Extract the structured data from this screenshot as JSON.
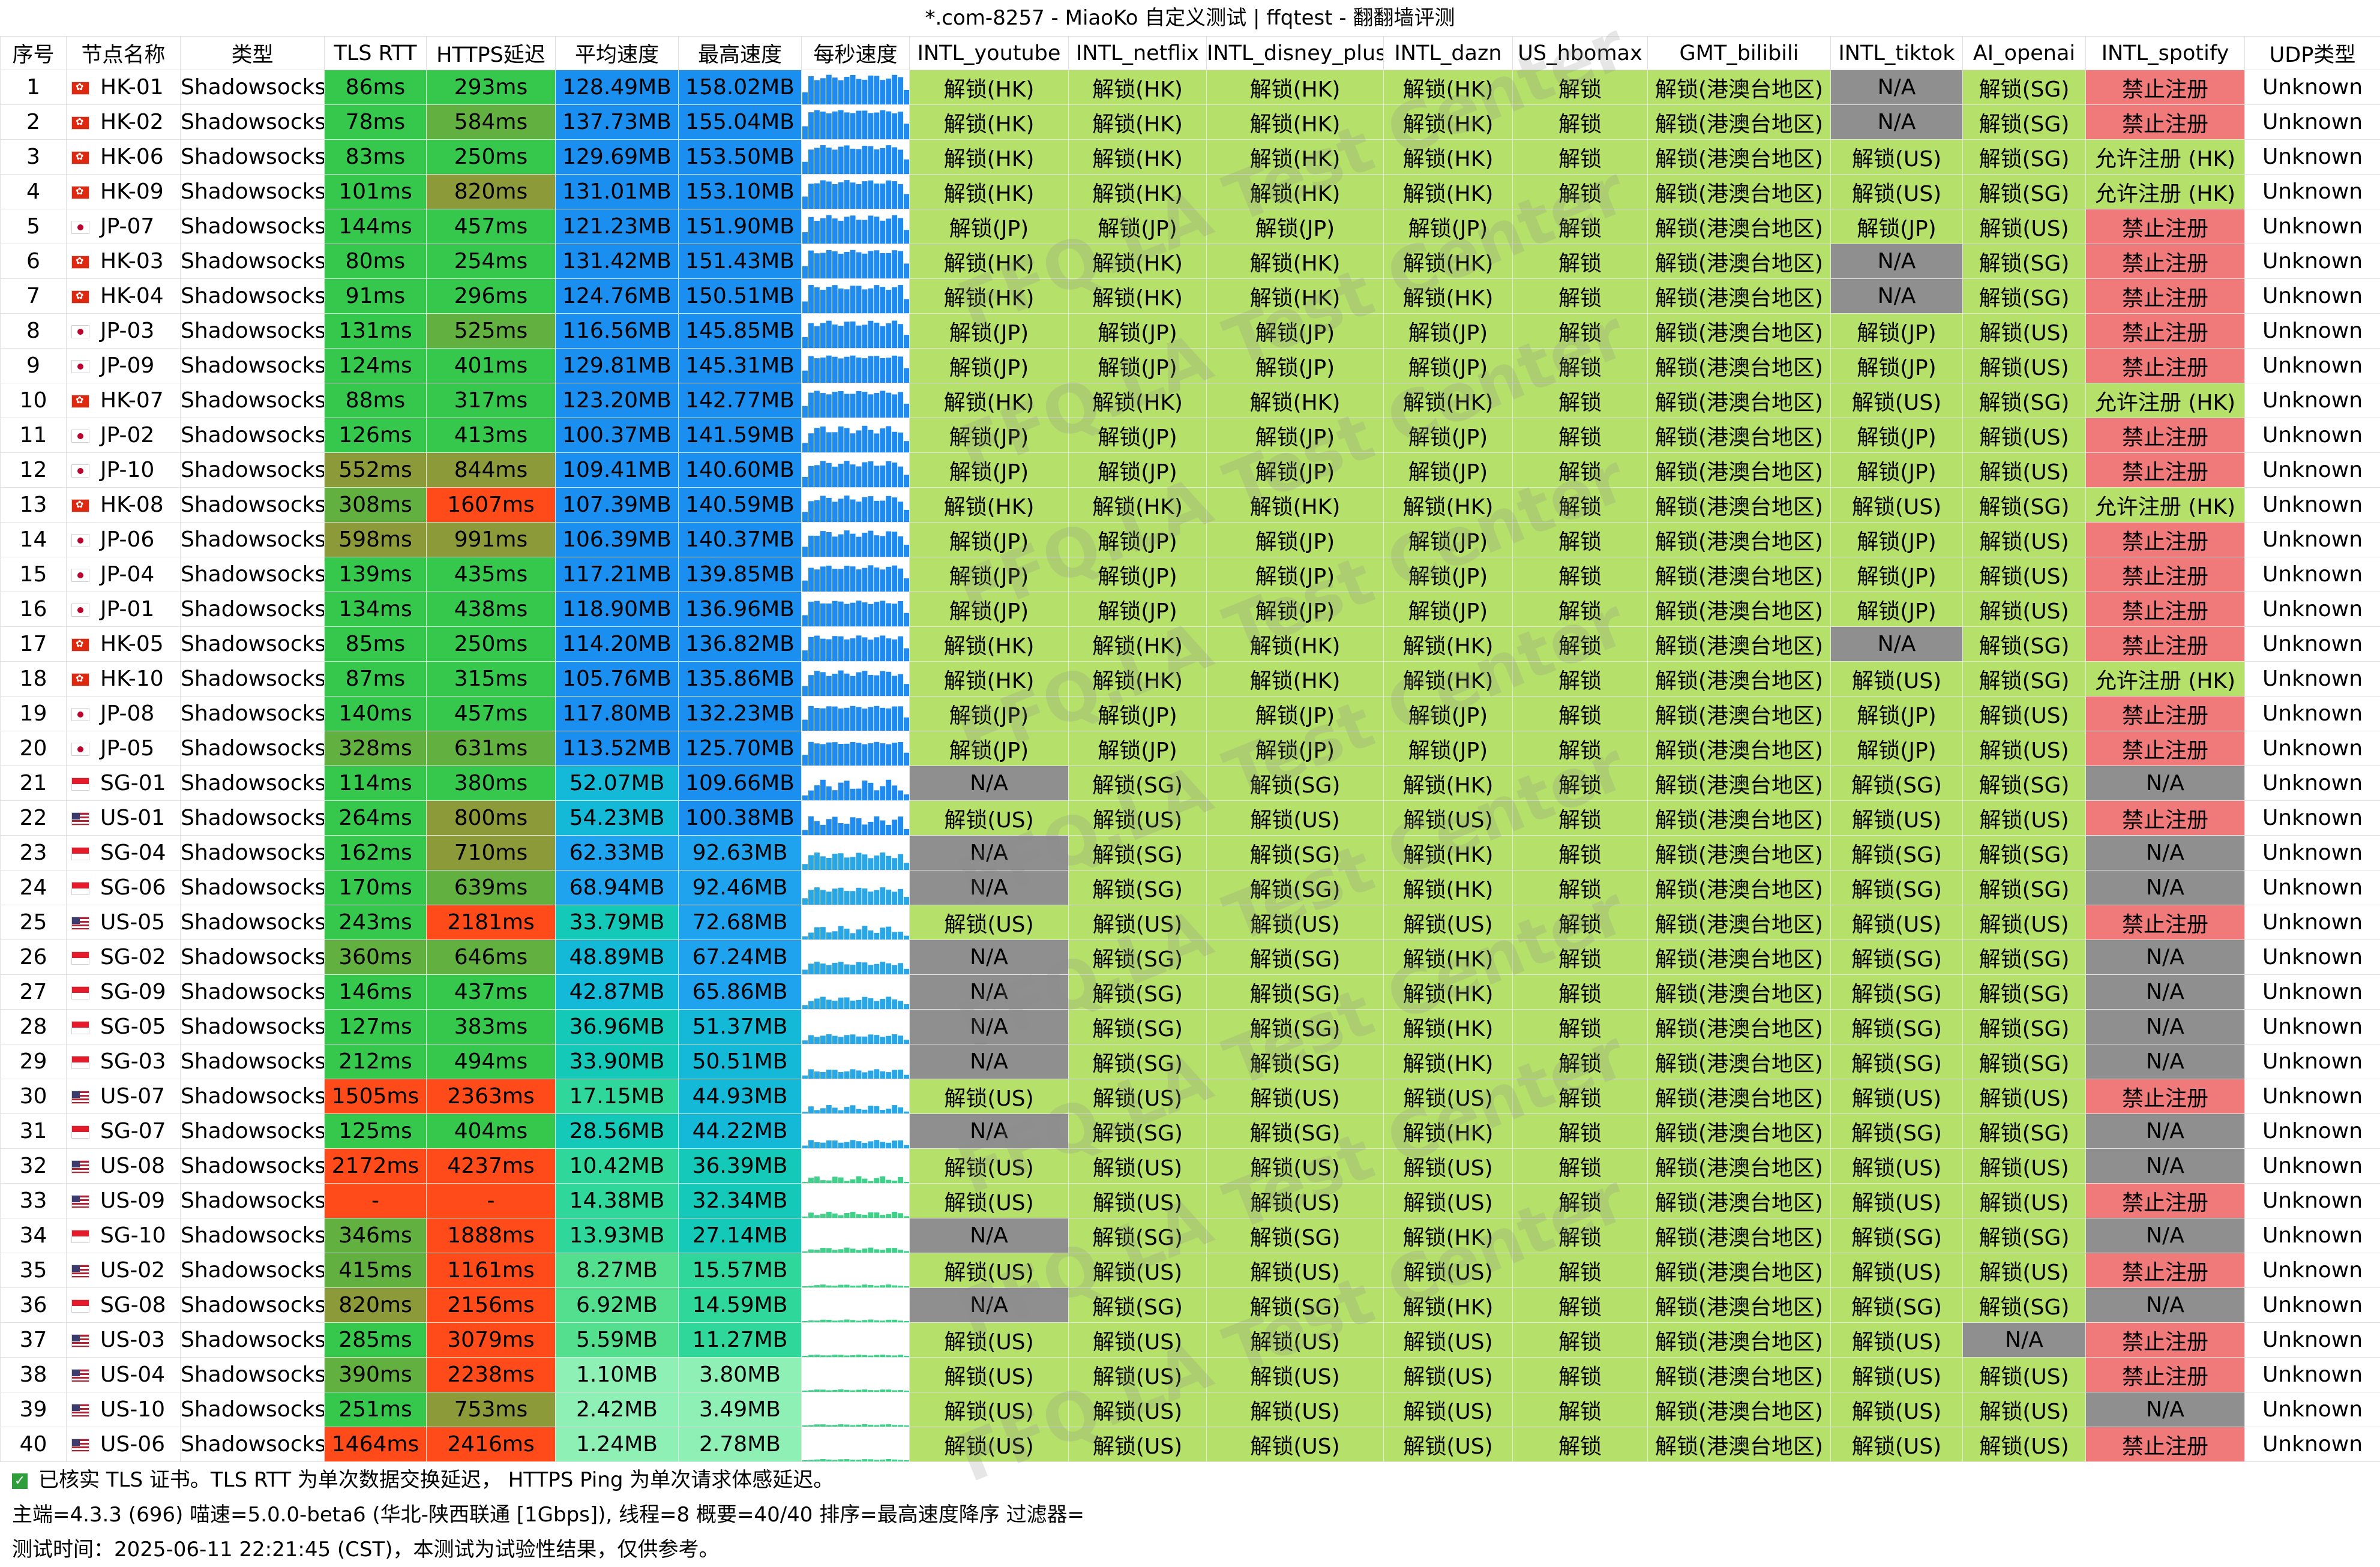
{
  "window_title": "*.com-8257 - MiaoKo 自定义测试 | ffqtest - 翻翻墙评测",
  "watermark": "FFQ.LA Test Center",
  "columns": [
    "序号",
    "节点名称",
    "类型",
    "TLS RTT",
    "HTTPS延迟",
    "平均速度",
    "最高速度",
    "每秒速度",
    "INTL_youtube",
    "INTL_netflix",
    "INTL_disney_plus",
    "INTL_dazn",
    "US_hbomax",
    "GMT_bilibili",
    "INTL_tiktok",
    "AI_openai",
    "INTL_spotify",
    "UDP类型"
  ],
  "rows": [
    {
      "idx": "1",
      "flag": "hk",
      "name": "HK-01",
      "type": "Shadowsocks",
      "tls": "86ms",
      "https": "293ms",
      "avg": "128.49MB",
      "max": "158.02MB",
      "yt": "解锁(HK)",
      "nf": "解锁(HK)",
      "dp": "解锁(HK)",
      "dazn": "解锁(HK)",
      "hbo": "解锁",
      "bili": "解锁(港澳台地区)",
      "tt": "N/A",
      "ai": "解锁(SG)",
      "sp": "禁止注册",
      "udp": "Unknown"
    },
    {
      "idx": "2",
      "flag": "hk",
      "name": "HK-02",
      "type": "Shadowsocks",
      "tls": "78ms",
      "https": "584ms",
      "avg": "137.73MB",
      "max": "155.04MB",
      "yt": "解锁(HK)",
      "nf": "解锁(HK)",
      "dp": "解锁(HK)",
      "dazn": "解锁(HK)",
      "hbo": "解锁",
      "bili": "解锁(港澳台地区)",
      "tt": "N/A",
      "ai": "解锁(SG)",
      "sp": "禁止注册",
      "udp": "Unknown"
    },
    {
      "idx": "3",
      "flag": "hk",
      "name": "HK-06",
      "type": "Shadowsocks",
      "tls": "83ms",
      "https": "250ms",
      "avg": "129.69MB",
      "max": "153.50MB",
      "yt": "解锁(HK)",
      "nf": "解锁(HK)",
      "dp": "解锁(HK)",
      "dazn": "解锁(HK)",
      "hbo": "解锁",
      "bili": "解锁(港澳台地区)",
      "tt": "解锁(US)",
      "ai": "解锁(SG)",
      "sp": "允许注册 (HK)",
      "udp": "Unknown"
    },
    {
      "idx": "4",
      "flag": "hk",
      "name": "HK-09",
      "type": "Shadowsocks",
      "tls": "101ms",
      "https": "820ms",
      "avg": "131.01MB",
      "max": "153.10MB",
      "yt": "解锁(HK)",
      "nf": "解锁(HK)",
      "dp": "解锁(HK)",
      "dazn": "解锁(HK)",
      "hbo": "解锁",
      "bili": "解锁(港澳台地区)",
      "tt": "解锁(US)",
      "ai": "解锁(SG)",
      "sp": "允许注册 (HK)",
      "udp": "Unknown"
    },
    {
      "idx": "5",
      "flag": "jp",
      "name": "JP-07",
      "type": "Shadowsocks",
      "tls": "144ms",
      "https": "457ms",
      "avg": "121.23MB",
      "max": "151.90MB",
      "yt": "解锁(JP)",
      "nf": "解锁(JP)",
      "dp": "解锁(JP)",
      "dazn": "解锁(JP)",
      "hbo": "解锁",
      "bili": "解锁(港澳台地区)",
      "tt": "解锁(JP)",
      "ai": "解锁(US)",
      "sp": "禁止注册",
      "udp": "Unknown"
    },
    {
      "idx": "6",
      "flag": "hk",
      "name": "HK-03",
      "type": "Shadowsocks",
      "tls": "80ms",
      "https": "254ms",
      "avg": "131.42MB",
      "max": "151.43MB",
      "yt": "解锁(HK)",
      "nf": "解锁(HK)",
      "dp": "解锁(HK)",
      "dazn": "解锁(HK)",
      "hbo": "解锁",
      "bili": "解锁(港澳台地区)",
      "tt": "N/A",
      "ai": "解锁(SG)",
      "sp": "禁止注册",
      "udp": "Unknown"
    },
    {
      "idx": "7",
      "flag": "hk",
      "name": "HK-04",
      "type": "Shadowsocks",
      "tls": "91ms",
      "https": "296ms",
      "avg": "124.76MB",
      "max": "150.51MB",
      "yt": "解锁(HK)",
      "nf": "解锁(HK)",
      "dp": "解锁(HK)",
      "dazn": "解锁(HK)",
      "hbo": "解锁",
      "bili": "解锁(港澳台地区)",
      "tt": "N/A",
      "ai": "解锁(SG)",
      "sp": "禁止注册",
      "udp": "Unknown"
    },
    {
      "idx": "8",
      "flag": "jp",
      "name": "JP-03",
      "type": "Shadowsocks",
      "tls": "131ms",
      "https": "525ms",
      "avg": "116.56MB",
      "max": "145.85MB",
      "yt": "解锁(JP)",
      "nf": "解锁(JP)",
      "dp": "解锁(JP)",
      "dazn": "解锁(JP)",
      "hbo": "解锁",
      "bili": "解锁(港澳台地区)",
      "tt": "解锁(JP)",
      "ai": "解锁(US)",
      "sp": "禁止注册",
      "udp": "Unknown"
    },
    {
      "idx": "9",
      "flag": "jp",
      "name": "JP-09",
      "type": "Shadowsocks",
      "tls": "124ms",
      "https": "401ms",
      "avg": "129.81MB",
      "max": "145.31MB",
      "yt": "解锁(JP)",
      "nf": "解锁(JP)",
      "dp": "解锁(JP)",
      "dazn": "解锁(JP)",
      "hbo": "解锁",
      "bili": "解锁(港澳台地区)",
      "tt": "解锁(JP)",
      "ai": "解锁(US)",
      "sp": "禁止注册",
      "udp": "Unknown"
    },
    {
      "idx": "10",
      "flag": "hk",
      "name": "HK-07",
      "type": "Shadowsocks",
      "tls": "88ms",
      "https": "317ms",
      "avg": "123.20MB",
      "max": "142.77MB",
      "yt": "解锁(HK)",
      "nf": "解锁(HK)",
      "dp": "解锁(HK)",
      "dazn": "解锁(HK)",
      "hbo": "解锁",
      "bili": "解锁(港澳台地区)",
      "tt": "解锁(US)",
      "ai": "解锁(SG)",
      "sp": "允许注册 (HK)",
      "udp": "Unknown"
    },
    {
      "idx": "11",
      "flag": "jp",
      "name": "JP-02",
      "type": "Shadowsocks",
      "tls": "126ms",
      "https": "413ms",
      "avg": "100.37MB",
      "max": "141.59MB",
      "yt": "解锁(JP)",
      "nf": "解锁(JP)",
      "dp": "解锁(JP)",
      "dazn": "解锁(JP)",
      "hbo": "解锁",
      "bili": "解锁(港澳台地区)",
      "tt": "解锁(JP)",
      "ai": "解锁(US)",
      "sp": "禁止注册",
      "udp": "Unknown"
    },
    {
      "idx": "12",
      "flag": "jp",
      "name": "JP-10",
      "type": "Shadowsocks",
      "tls": "552ms",
      "https": "844ms",
      "avg": "109.41MB",
      "max": "140.60MB",
      "yt": "解锁(JP)",
      "nf": "解锁(JP)",
      "dp": "解锁(JP)",
      "dazn": "解锁(JP)",
      "hbo": "解锁",
      "bili": "解锁(港澳台地区)",
      "tt": "解锁(JP)",
      "ai": "解锁(US)",
      "sp": "禁止注册",
      "udp": "Unknown"
    },
    {
      "idx": "13",
      "flag": "hk",
      "name": "HK-08",
      "type": "Shadowsocks",
      "tls": "308ms",
      "https": "1607ms",
      "avg": "107.39MB",
      "max": "140.59MB",
      "yt": "解锁(HK)",
      "nf": "解锁(HK)",
      "dp": "解锁(HK)",
      "dazn": "解锁(HK)",
      "hbo": "解锁",
      "bili": "解锁(港澳台地区)",
      "tt": "解锁(US)",
      "ai": "解锁(SG)",
      "sp": "允许注册 (HK)",
      "udp": "Unknown"
    },
    {
      "idx": "14",
      "flag": "jp",
      "name": "JP-06",
      "type": "Shadowsocks",
      "tls": "598ms",
      "https": "991ms",
      "avg": "106.39MB",
      "max": "140.37MB",
      "yt": "解锁(JP)",
      "nf": "解锁(JP)",
      "dp": "解锁(JP)",
      "dazn": "解锁(JP)",
      "hbo": "解锁",
      "bili": "解锁(港澳台地区)",
      "tt": "解锁(JP)",
      "ai": "解锁(US)",
      "sp": "禁止注册",
      "udp": "Unknown"
    },
    {
      "idx": "15",
      "flag": "jp",
      "name": "JP-04",
      "type": "Shadowsocks",
      "tls": "139ms",
      "https": "435ms",
      "avg": "117.21MB",
      "max": "139.85MB",
      "yt": "解锁(JP)",
      "nf": "解锁(JP)",
      "dp": "解锁(JP)",
      "dazn": "解锁(JP)",
      "hbo": "解锁",
      "bili": "解锁(港澳台地区)",
      "tt": "解锁(JP)",
      "ai": "解锁(US)",
      "sp": "禁止注册",
      "udp": "Unknown"
    },
    {
      "idx": "16",
      "flag": "jp",
      "name": "JP-01",
      "type": "Shadowsocks",
      "tls": "134ms",
      "https": "438ms",
      "avg": "118.90MB",
      "max": "136.96MB",
      "yt": "解锁(JP)",
      "nf": "解锁(JP)",
      "dp": "解锁(JP)",
      "dazn": "解锁(JP)",
      "hbo": "解锁",
      "bili": "解锁(港澳台地区)",
      "tt": "解锁(JP)",
      "ai": "解锁(US)",
      "sp": "禁止注册",
      "udp": "Unknown"
    },
    {
      "idx": "17",
      "flag": "hk",
      "name": "HK-05",
      "type": "Shadowsocks",
      "tls": "85ms",
      "https": "250ms",
      "avg": "114.20MB",
      "max": "136.82MB",
      "yt": "解锁(HK)",
      "nf": "解锁(HK)",
      "dp": "解锁(HK)",
      "dazn": "解锁(HK)",
      "hbo": "解锁",
      "bili": "解锁(港澳台地区)",
      "tt": "N/A",
      "ai": "解锁(SG)",
      "sp": "禁止注册",
      "udp": "Unknown"
    },
    {
      "idx": "18",
      "flag": "hk",
      "name": "HK-10",
      "type": "Shadowsocks",
      "tls": "87ms",
      "https": "315ms",
      "avg": "105.76MB",
      "max": "135.86MB",
      "yt": "解锁(HK)",
      "nf": "解锁(HK)",
      "dp": "解锁(HK)",
      "dazn": "解锁(HK)",
      "hbo": "解锁",
      "bili": "解锁(港澳台地区)",
      "tt": "解锁(US)",
      "ai": "解锁(SG)",
      "sp": "允许注册 (HK)",
      "udp": "Unknown"
    },
    {
      "idx": "19",
      "flag": "jp",
      "name": "JP-08",
      "type": "Shadowsocks",
      "tls": "140ms",
      "https": "457ms",
      "avg": "117.80MB",
      "max": "132.23MB",
      "yt": "解锁(JP)",
      "nf": "解锁(JP)",
      "dp": "解锁(JP)",
      "dazn": "解锁(JP)",
      "hbo": "解锁",
      "bili": "解锁(港澳台地区)",
      "tt": "解锁(JP)",
      "ai": "解锁(US)",
      "sp": "禁止注册",
      "udp": "Unknown"
    },
    {
      "idx": "20",
      "flag": "jp",
      "name": "JP-05",
      "type": "Shadowsocks",
      "tls": "328ms",
      "https": "631ms",
      "avg": "113.52MB",
      "max": "125.70MB",
      "yt": "解锁(JP)",
      "nf": "解锁(JP)",
      "dp": "解锁(JP)",
      "dazn": "解锁(JP)",
      "hbo": "解锁",
      "bili": "解锁(港澳台地区)",
      "tt": "解锁(JP)",
      "ai": "解锁(US)",
      "sp": "禁止注册",
      "udp": "Unknown"
    },
    {
      "idx": "21",
      "flag": "sg",
      "name": "SG-01",
      "type": "Shadowsocks",
      "tls": "114ms",
      "https": "380ms",
      "avg": "52.07MB",
      "max": "109.66MB",
      "yt": "N/A",
      "nf": "解锁(SG)",
      "dp": "解锁(SG)",
      "dazn": "解锁(HK)",
      "hbo": "解锁",
      "bili": "解锁(港澳台地区)",
      "tt": "解锁(SG)",
      "ai": "解锁(SG)",
      "sp": "N/A",
      "udp": "Unknown"
    },
    {
      "idx": "22",
      "flag": "us",
      "name": "US-01",
      "type": "Shadowsocks",
      "tls": "264ms",
      "https": "800ms",
      "avg": "54.23MB",
      "max": "100.38MB",
      "yt": "解锁(US)",
      "nf": "解锁(US)",
      "dp": "解锁(US)",
      "dazn": "解锁(US)",
      "hbo": "解锁",
      "bili": "解锁(港澳台地区)",
      "tt": "解锁(US)",
      "ai": "解锁(US)",
      "sp": "禁止注册",
      "udp": "Unknown"
    },
    {
      "idx": "23",
      "flag": "sg",
      "name": "SG-04",
      "type": "Shadowsocks",
      "tls": "162ms",
      "https": "710ms",
      "avg": "62.33MB",
      "max": "92.63MB",
      "yt": "N/A",
      "nf": "解锁(SG)",
      "dp": "解锁(SG)",
      "dazn": "解锁(HK)",
      "hbo": "解锁",
      "bili": "解锁(港澳台地区)",
      "tt": "解锁(SG)",
      "ai": "解锁(SG)",
      "sp": "N/A",
      "udp": "Unknown"
    },
    {
      "idx": "24",
      "flag": "sg",
      "name": "SG-06",
      "type": "Shadowsocks",
      "tls": "170ms",
      "https": "639ms",
      "avg": "68.94MB",
      "max": "92.46MB",
      "yt": "N/A",
      "nf": "解锁(SG)",
      "dp": "解锁(SG)",
      "dazn": "解锁(HK)",
      "hbo": "解锁",
      "bili": "解锁(港澳台地区)",
      "tt": "解锁(SG)",
      "ai": "解锁(SG)",
      "sp": "N/A",
      "udp": "Unknown"
    },
    {
      "idx": "25",
      "flag": "us",
      "name": "US-05",
      "type": "Shadowsocks",
      "tls": "243ms",
      "https": "2181ms",
      "avg": "33.79MB",
      "max": "72.68MB",
      "yt": "解锁(US)",
      "nf": "解锁(US)",
      "dp": "解锁(US)",
      "dazn": "解锁(US)",
      "hbo": "解锁",
      "bili": "解锁(港澳台地区)",
      "tt": "解锁(US)",
      "ai": "解锁(US)",
      "sp": "禁止注册",
      "udp": "Unknown"
    },
    {
      "idx": "26",
      "flag": "sg",
      "name": "SG-02",
      "type": "Shadowsocks",
      "tls": "360ms",
      "https": "646ms",
      "avg": "48.89MB",
      "max": "67.24MB",
      "yt": "N/A",
      "nf": "解锁(SG)",
      "dp": "解锁(SG)",
      "dazn": "解锁(HK)",
      "hbo": "解锁",
      "bili": "解锁(港澳台地区)",
      "tt": "解锁(SG)",
      "ai": "解锁(SG)",
      "sp": "N/A",
      "udp": "Unknown"
    },
    {
      "idx": "27",
      "flag": "sg",
      "name": "SG-09",
      "type": "Shadowsocks",
      "tls": "146ms",
      "https": "437ms",
      "avg": "42.87MB",
      "max": "65.86MB",
      "yt": "N/A",
      "nf": "解锁(SG)",
      "dp": "解锁(SG)",
      "dazn": "解锁(HK)",
      "hbo": "解锁",
      "bili": "解锁(港澳台地区)",
      "tt": "解锁(SG)",
      "ai": "解锁(SG)",
      "sp": "N/A",
      "udp": "Unknown"
    },
    {
      "idx": "28",
      "flag": "sg",
      "name": "SG-05",
      "type": "Shadowsocks",
      "tls": "127ms",
      "https": "383ms",
      "avg": "36.96MB",
      "max": "51.37MB",
      "yt": "N/A",
      "nf": "解锁(SG)",
      "dp": "解锁(SG)",
      "dazn": "解锁(HK)",
      "hbo": "解锁",
      "bili": "解锁(港澳台地区)",
      "tt": "解锁(SG)",
      "ai": "解锁(SG)",
      "sp": "N/A",
      "udp": "Unknown"
    },
    {
      "idx": "29",
      "flag": "sg",
      "name": "SG-03",
      "type": "Shadowsocks",
      "tls": "212ms",
      "https": "494ms",
      "avg": "33.90MB",
      "max": "50.51MB",
      "yt": "N/A",
      "nf": "解锁(SG)",
      "dp": "解锁(SG)",
      "dazn": "解锁(HK)",
      "hbo": "解锁",
      "bili": "解锁(港澳台地区)",
      "tt": "解锁(SG)",
      "ai": "解锁(SG)",
      "sp": "N/A",
      "udp": "Unknown"
    },
    {
      "idx": "30",
      "flag": "us",
      "name": "US-07",
      "type": "Shadowsocks",
      "tls": "1505ms",
      "https": "2363ms",
      "avg": "17.15MB",
      "max": "44.93MB",
      "yt": "解锁(US)",
      "nf": "解锁(US)",
      "dp": "解锁(US)",
      "dazn": "解锁(US)",
      "hbo": "解锁",
      "bili": "解锁(港澳台地区)",
      "tt": "解锁(US)",
      "ai": "解锁(US)",
      "sp": "禁止注册",
      "udp": "Unknown"
    },
    {
      "idx": "31",
      "flag": "sg",
      "name": "SG-07",
      "type": "Shadowsocks",
      "tls": "125ms",
      "https": "404ms",
      "avg": "28.56MB",
      "max": "44.22MB",
      "yt": "N/A",
      "nf": "解锁(SG)",
      "dp": "解锁(SG)",
      "dazn": "解锁(HK)",
      "hbo": "解锁",
      "bili": "解锁(港澳台地区)",
      "tt": "解锁(SG)",
      "ai": "解锁(SG)",
      "sp": "N/A",
      "udp": "Unknown"
    },
    {
      "idx": "32",
      "flag": "us",
      "name": "US-08",
      "type": "Shadowsocks",
      "tls": "2172ms",
      "https": "4237ms",
      "avg": "10.42MB",
      "max": "36.39MB",
      "yt": "解锁(US)",
      "nf": "解锁(US)",
      "dp": "解锁(US)",
      "dazn": "解锁(US)",
      "hbo": "解锁",
      "bili": "解锁(港澳台地区)",
      "tt": "解锁(US)",
      "ai": "解锁(US)",
      "sp": "N/A",
      "udp": "Unknown"
    },
    {
      "idx": "33",
      "flag": "us",
      "name": "US-09",
      "type": "Shadowsocks",
      "tls": "-",
      "https": "-",
      "avg": "14.38MB",
      "max": "32.34MB",
      "yt": "解锁(US)",
      "nf": "解锁(US)",
      "dp": "解锁(US)",
      "dazn": "解锁(US)",
      "hbo": "解锁",
      "bili": "解锁(港澳台地区)",
      "tt": "解锁(US)",
      "ai": "解锁(US)",
      "sp": "禁止注册",
      "udp": "Unknown"
    },
    {
      "idx": "34",
      "flag": "sg",
      "name": "SG-10",
      "type": "Shadowsocks",
      "tls": "346ms",
      "https": "1888ms",
      "avg": "13.93MB",
      "max": "27.14MB",
      "yt": "N/A",
      "nf": "解锁(SG)",
      "dp": "解锁(SG)",
      "dazn": "解锁(HK)",
      "hbo": "解锁",
      "bili": "解锁(港澳台地区)",
      "tt": "解锁(SG)",
      "ai": "解锁(SG)",
      "sp": "N/A",
      "udp": "Unknown"
    },
    {
      "idx": "35",
      "flag": "us",
      "name": "US-02",
      "type": "Shadowsocks",
      "tls": "415ms",
      "https": "1161ms",
      "avg": "8.27MB",
      "max": "15.57MB",
      "yt": "解锁(US)",
      "nf": "解锁(US)",
      "dp": "解锁(US)",
      "dazn": "解锁(US)",
      "hbo": "解锁",
      "bili": "解锁(港澳台地区)",
      "tt": "解锁(US)",
      "ai": "解锁(US)",
      "sp": "禁止注册",
      "udp": "Unknown"
    },
    {
      "idx": "36",
      "flag": "sg",
      "name": "SG-08",
      "type": "Shadowsocks",
      "tls": "820ms",
      "https": "2156ms",
      "avg": "6.92MB",
      "max": "14.59MB",
      "yt": "N/A",
      "nf": "解锁(SG)",
      "dp": "解锁(SG)",
      "dazn": "解锁(HK)",
      "hbo": "解锁",
      "bili": "解锁(港澳台地区)",
      "tt": "解锁(SG)",
      "ai": "解锁(SG)",
      "sp": "N/A",
      "udp": "Unknown"
    },
    {
      "idx": "37",
      "flag": "us",
      "name": "US-03",
      "type": "Shadowsocks",
      "tls": "285ms",
      "https": "3079ms",
      "avg": "5.59MB",
      "max": "11.27MB",
      "yt": "解锁(US)",
      "nf": "解锁(US)",
      "dp": "解锁(US)",
      "dazn": "解锁(US)",
      "hbo": "解锁",
      "bili": "解锁(港澳台地区)",
      "tt": "解锁(US)",
      "ai": "N/A",
      "sp": "禁止注册",
      "udp": "Unknown"
    },
    {
      "idx": "38",
      "flag": "us",
      "name": "US-04",
      "type": "Shadowsocks",
      "tls": "390ms",
      "https": "2238ms",
      "avg": "1.10MB",
      "max": "3.80MB",
      "yt": "解锁(US)",
      "nf": "解锁(US)",
      "dp": "解锁(US)",
      "dazn": "解锁(US)",
      "hbo": "解锁",
      "bili": "解锁(港澳台地区)",
      "tt": "解锁(US)",
      "ai": "解锁(US)",
      "sp": "禁止注册",
      "udp": "Unknown"
    },
    {
      "idx": "39",
      "flag": "us",
      "name": "US-10",
      "type": "Shadowsocks",
      "tls": "251ms",
      "https": "753ms",
      "avg": "2.42MB",
      "max": "3.49MB",
      "yt": "解锁(US)",
      "nf": "解锁(US)",
      "dp": "解锁(US)",
      "dazn": "解锁(US)",
      "hbo": "解锁",
      "bili": "解锁(港澳台地区)",
      "tt": "解锁(US)",
      "ai": "解锁(US)",
      "sp": "N/A",
      "udp": "Unknown"
    },
    {
      "idx": "40",
      "flag": "us",
      "name": "US-06",
      "type": "Shadowsocks",
      "tls": "1464ms",
      "https": "2416ms",
      "avg": "1.24MB",
      "max": "2.78MB",
      "yt": "解锁(US)",
      "nf": "解锁(US)",
      "dp": "解锁(US)",
      "dazn": "解锁(US)",
      "hbo": "解锁",
      "bili": "解锁(港澳台地区)",
      "tt": "解锁(US)",
      "ai": "解锁(US)",
      "sp": "禁止注册",
      "udp": "Unknown"
    }
  ],
  "status": {
    "line1": "已核实 TLS 证书。TLS RTT 为单次数据交换延迟， HTTPS Ping 为单次请求体感延迟。",
    "line2": "主端=4.3.3 (696) 喵速=5.0.0-beta6 (华北-陕西联通 [1Gbps]), 线程=8 概要=40/40 排序=最高速度降序 过滤器=",
    "line3": "测试时间：2025-06-11 22:21:45 (CST)，本测试为试验性结果，仅供参考。"
  },
  "colors": {
    "unlock_green": "#b5e06a",
    "na_gray": "#8f8f8f",
    "ban_red": "#f07a7a",
    "allow_green": "#b5e06a",
    "latency_good": "#35c84c",
    "latency_mid": "#8c9a3a",
    "latency_bad": "#ff4a1a",
    "spark_blue": "#1f8bf0",
    "spark_green": "#3fd08a"
  }
}
